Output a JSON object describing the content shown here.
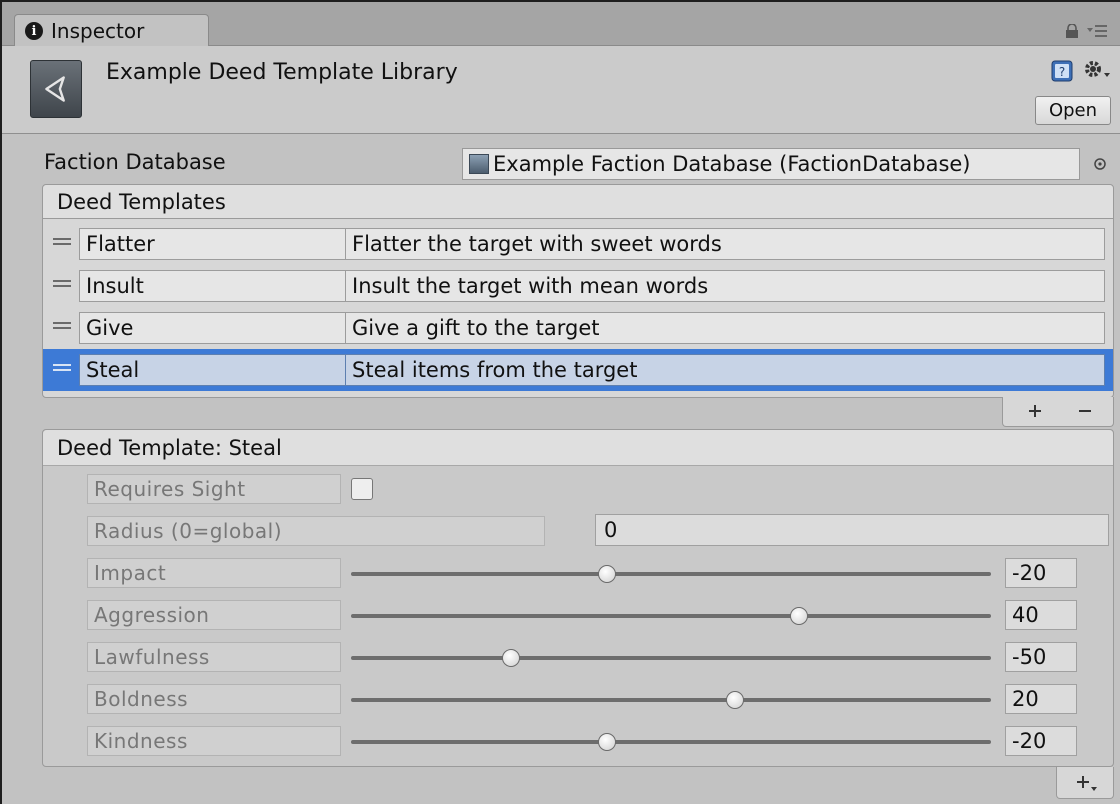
{
  "window": {
    "tab_label": "Inspector",
    "icons": [
      "info-icon",
      "lock-icon",
      "menu-icon"
    ]
  },
  "header": {
    "title": "Example Deed Template Library",
    "open_label": "Open",
    "icons": [
      "unity-asset-icon",
      "help-icon",
      "gear-icon"
    ]
  },
  "faction_database": {
    "label": "Faction Database",
    "value": "Example Faction Database (FactionDatabase)"
  },
  "deed_templates": {
    "header": "Deed Templates",
    "rows": [
      {
        "name": "Flatter",
        "description": "Flatter the target with sweet words",
        "selected": false
      },
      {
        "name": "Insult",
        "description": "Insult the target with mean words",
        "selected": false
      },
      {
        "name": "Give",
        "description": "Give a gift to the target",
        "selected": false
      },
      {
        "name": "Steal",
        "description": "Steal items from the target",
        "selected": true
      }
    ],
    "add_label": "+",
    "remove_label": "−"
  },
  "deed_template": {
    "header": "Deed Template: Steal",
    "requires_sight": {
      "label": "Requires Sight",
      "checked": false
    },
    "radius": {
      "label": "Radius (0=global)",
      "value": "0"
    },
    "sliders": [
      {
        "label": "Impact",
        "value": "-20",
        "min": -100,
        "max": 100
      },
      {
        "label": "Aggression",
        "value": "40",
        "min": -100,
        "max": 100
      },
      {
        "label": "Lawfulness",
        "value": "-50",
        "min": -100,
        "max": 100
      },
      {
        "label": "Boldness",
        "value": "20",
        "min": -100,
        "max": 100
      },
      {
        "label": "Kindness",
        "value": "-20",
        "min": -100,
        "max": 100
      }
    ],
    "add_component_label": "+,"
  },
  "colors": {
    "background": "#c2c2c2",
    "selection": "#3d7ad6",
    "titlebar": "#a5a5a5"
  }
}
